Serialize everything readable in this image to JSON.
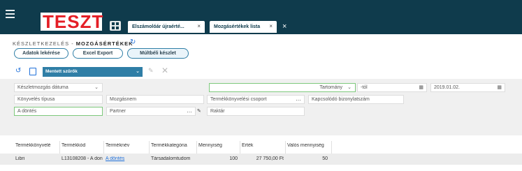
{
  "header": {
    "logo": "TESZT",
    "tabs": [
      {
        "label": "Elszámolóár újraérté..."
      },
      {
        "label": "Mozgásértékek lista"
      }
    ],
    "tab_close": "×"
  },
  "breadcrumb": {
    "parent": "KÉSZLETKEZELÉS - ",
    "current": "MOZGÁSÉRTÉKEK"
  },
  "actions": {
    "data_query": "Adatok lekérése",
    "excel_export": "Excel Export",
    "historical_stock": "Múltbéli készlet"
  },
  "filter_toolbar": {
    "saved_filters": "Mentett szűrők"
  },
  "filters": {
    "date_field": "Készletmozgás dátuma",
    "range": "Tartomány",
    "from_placeholder": "-tól",
    "to_value": "2019.01.02.",
    "ledger_type": "Könyvelés típusa",
    "movement_no": "Mozgásnem",
    "ledger_group": "Termékkönyvelési csoport",
    "related_doc": "Kapcsolódó bizonylatszám",
    "product": "A döntés",
    "partner": "Partner",
    "warehouse": "Raktár"
  },
  "table": {
    "columns": [
      "Termékkönyvelé",
      "Termékkód",
      "Terméknév",
      "Termékkategória",
      "Mennyiség",
      "Érték",
      "Valós mennyiség"
    ],
    "rows": [
      [
        "Libri",
        "L13108208 - A don",
        "A döntés",
        "Társadalomtudom",
        "100",
        "27 750,00 Ft",
        "50"
      ]
    ]
  },
  "colors": {
    "topbar": "#0f3b4c",
    "logo_red": "#e41e26",
    "accent": "#2f7ea6",
    "link": "#1e6fd9"
  }
}
